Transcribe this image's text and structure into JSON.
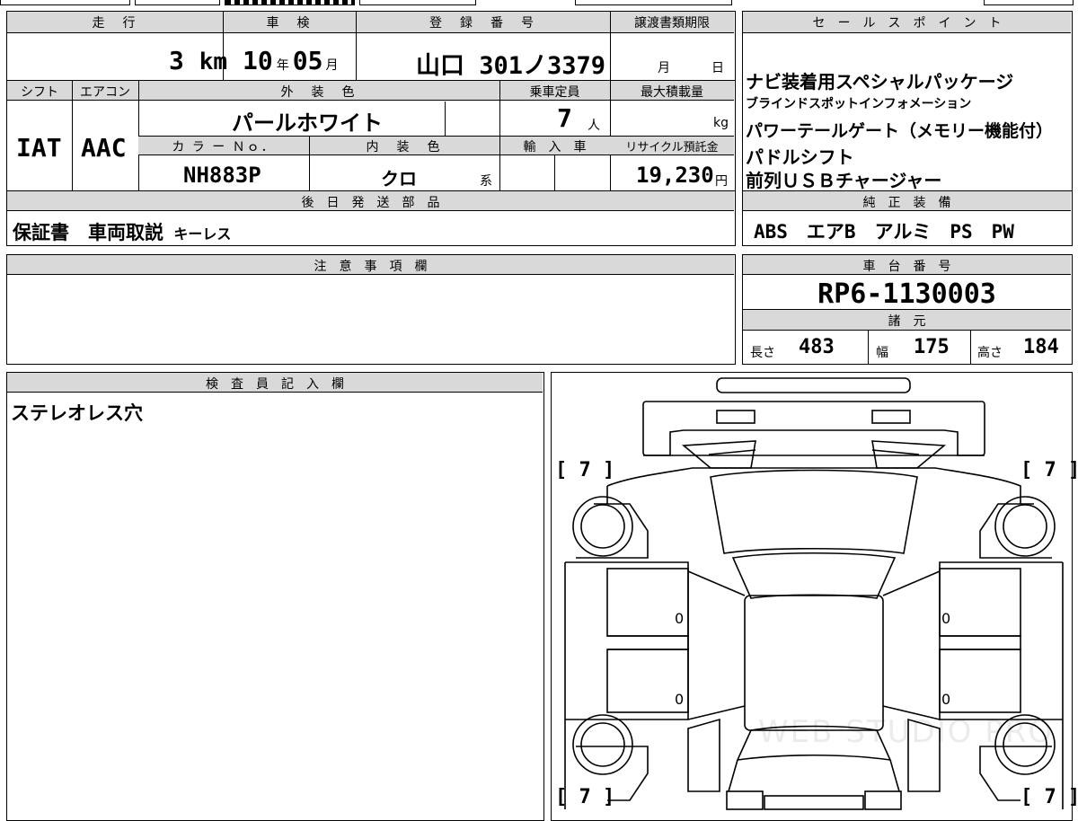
{
  "top_left": {
    "headers": {
      "mileage": "走　行",
      "inspection": "車　検",
      "registration": "登　録　番　号",
      "deadline": "譲渡書類期限"
    },
    "mileage_value": "3",
    "mileage_unit": "km",
    "inspection_year": "10",
    "year_unit": "年",
    "inspection_month": "05",
    "month_unit": "月",
    "registration_value": "山口 301ノ3379",
    "deadline_month": "月",
    "deadline_day": "日",
    "row2_headers": {
      "shift": "シフト",
      "aircon": "エアコン",
      "exterior_color": "外　装　色",
      "capacity": "乗車定員",
      "max_load": "最大積載量"
    },
    "shift_value": "IAT",
    "aircon_value": "AAC",
    "exterior_color_value": "パールホワイト",
    "capacity_value": "7",
    "capacity_unit": "人",
    "max_load_unit": "kg",
    "row3_headers": {
      "color_no": "カ ラ ー Ｎｏ．",
      "interior_color": "内　装　色",
      "import": "輸　入　車",
      "recycle": "リサイクル預託金"
    },
    "color_no_value": "NH883P",
    "interior_color_value": "クロ",
    "interior_suffix": "系",
    "recycle_value": "19,230",
    "recycle_unit": "円",
    "later_parts_header": "後　日　発　送　部　品",
    "later_parts_value": "保証書　車両取説",
    "later_parts_small": "キーレス"
  },
  "sales_points": {
    "header": "セ　ー　ル　ス　ポ　イ　ン　ト",
    "lines": [
      "ナビ装着用スペシャルパッケージ",
      "ブラインドスポットインフォメーション",
      "パワーテールゲート（メモリー機能付）",
      "パドルシフト",
      "前列ＵＳＢチャージャー"
    ]
  },
  "standard_equipment": {
    "header": "純　正　装　備",
    "value": "ABS　エアB　アルミ　PS　PW"
  },
  "notes": {
    "header": "注　意　事　項　欄",
    "value": ""
  },
  "chassis": {
    "header": "車　台　番　号",
    "value": "RP6-1130003"
  },
  "specs": {
    "header": "諸　元",
    "length_label": "長さ",
    "length_value": "483",
    "width_label": "幅",
    "width_value": "175",
    "height_label": "高さ",
    "height_value": "184"
  },
  "inspector": {
    "header": "検　査　員　記　入　欄",
    "value": "ステレオレス穴"
  },
  "diagram": {
    "tread_tl": "[ 7 ]",
    "tread_tr": "[ 7 ]",
    "tread_bl": "[ 7 ]",
    "tread_br": "[ 7 ]",
    "door_marks": [
      "0",
      "0",
      "0",
      "0"
    ],
    "watermark": "WEB STUDIO PRO"
  }
}
